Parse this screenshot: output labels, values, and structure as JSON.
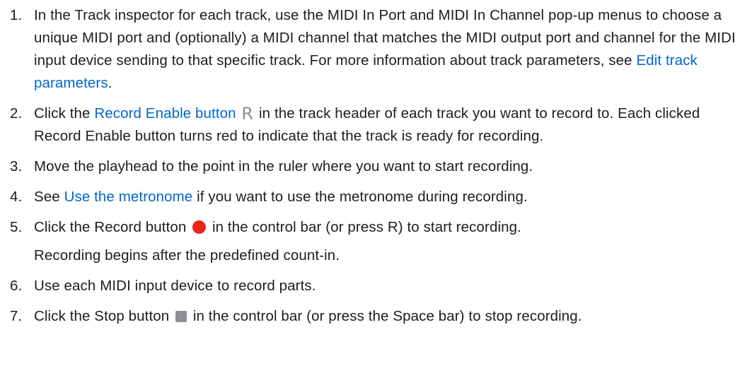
{
  "colors": {
    "link": "#0066cc",
    "text": "#1d1d1f",
    "record_red": "#e8261c",
    "icon_gray": "#8e8e93"
  },
  "steps": [
    {
      "num": "1.",
      "t1": "In the Track inspector for each track, use the MIDI In Port and MIDI In Channel pop-up menus to choose a unique MIDI port and (optionally) a MIDI channel that matches the MIDI output port and channel for the MIDI input device sending to that specific track. For more information about track parameters, see ",
      "link": "Edit track parameters",
      "t2": "."
    },
    {
      "num": "2.",
      "t1": "Click the ",
      "link": "Record Enable button",
      "icon": "R",
      "icon_name": "record-enable-icon",
      "t2": " in the track header of each track you want to record to. Each clicked Record Enable button turns red to indicate that the track is ready for recording."
    },
    {
      "num": "3.",
      "t1": "Move the playhead to the point in the ruler where you want to start recording."
    },
    {
      "num": "4.",
      "t1": "See ",
      "link": "Use the metronome",
      "t2": " if you want to use the metronome during recording."
    },
    {
      "num": "5.",
      "t1": "Click the Record button ",
      "icon_name": "record-icon",
      "t2": " in the control bar (or press R) to start recording.",
      "sub": "Recording begins after the predefined count-in."
    },
    {
      "num": "6.",
      "t1": "Use each MIDI input device to record parts."
    },
    {
      "num": "7.",
      "t1": "Click the Stop button ",
      "icon_name": "stop-icon",
      "t2": " in the control bar (or press the Space bar) to stop recording."
    }
  ]
}
